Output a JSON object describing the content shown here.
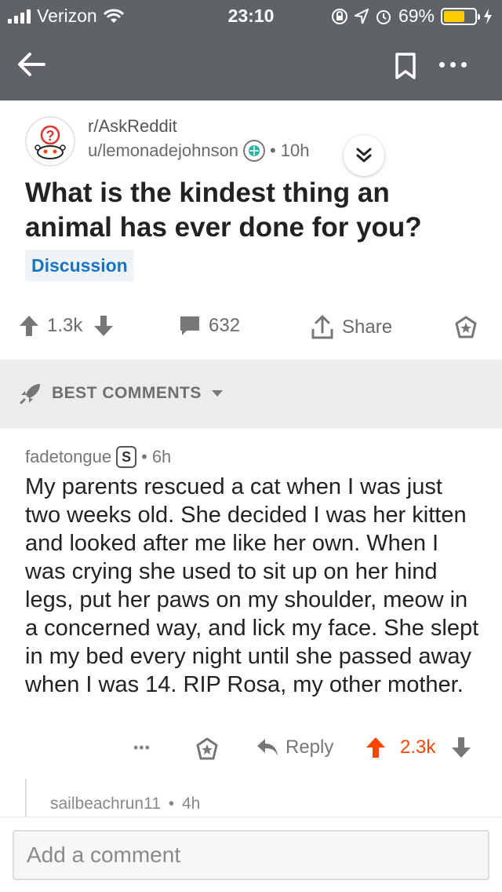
{
  "status_bar": {
    "carrier": "Verizon",
    "time": "23:10",
    "battery_percent": "69%",
    "battery_level": 0.69,
    "battery_color": "#ffcc00"
  },
  "nav": {
    "back_icon": "back-arrow-icon",
    "bookmark_icon": "bookmark-icon",
    "more_icon": "more-dots-icon"
  },
  "post": {
    "subreddit": "r/AskReddit",
    "author": "u/lemonadejohnson",
    "separator": "•",
    "age": "10h",
    "title": "What is the kindest thing an animal has ever done for you?",
    "flair": "Discussion",
    "upvotes": "1.3k",
    "comments": "632",
    "share_label": "Share"
  },
  "sort": {
    "label": "BEST COMMENTS"
  },
  "comment": {
    "author": "fadetongue",
    "badge": "S",
    "separator": "•",
    "age": "6h",
    "body": "My parents rescued a cat when I was just two weeks old. She decided I was her kitten and looked after me like her own. When I was crying she used to sit up on her hind legs, put her paws on my shoulder, meow in a concerned way, and lick my face. She slept in my bed every night until she passed away when I was 14. RIP Rosa, my other mother.",
    "more_label": "•••",
    "reply_label": "Reply",
    "score": "2.3k",
    "upvote_color": "#ff4500"
  },
  "reply_preview": {
    "author": "sailbeachrun11",
    "separator": "•",
    "age": "4h"
  },
  "composer": {
    "placeholder": "Add a comment"
  },
  "colors": {
    "header_bg": "#5f6368",
    "flair_text": "#1a73c2",
    "accent_orange": "#ff4500"
  }
}
